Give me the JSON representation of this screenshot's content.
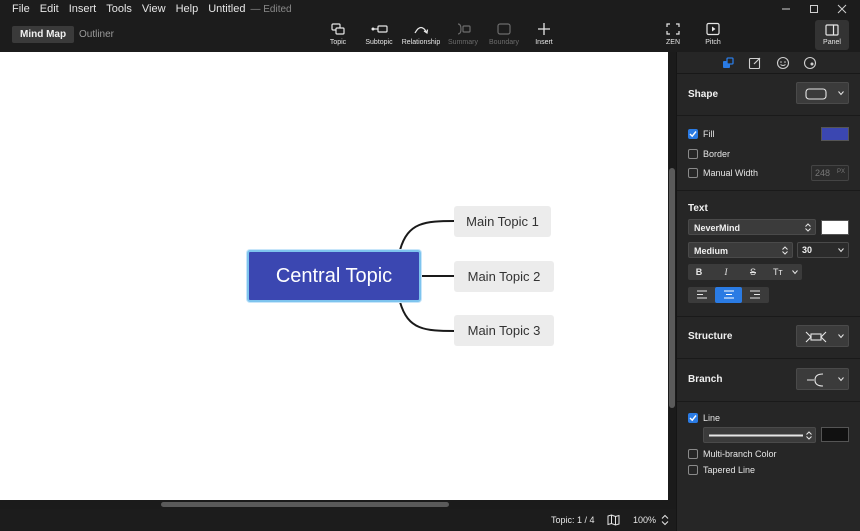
{
  "menu": {
    "items": [
      "File",
      "Edit",
      "Insert",
      "Tools",
      "View",
      "Help"
    ],
    "doc_title": "Untitled",
    "doc_status": "— Edited"
  },
  "view_tabs": {
    "mind_map": "Mind Map",
    "outliner": "Outliner"
  },
  "toolbar": {
    "topic": "Topic",
    "subtopic": "Subtopic",
    "relationship": "Relationship",
    "summary": "Summary",
    "boundary": "Boundary",
    "insert": "Insert",
    "zen": "ZEN",
    "pitch": "Pitch",
    "panel": "Panel"
  },
  "mindmap": {
    "central": "Central Topic",
    "topics": [
      "Main Topic 1",
      "Main Topic 2",
      "Main Topic 3"
    ]
  },
  "status": {
    "topic_count": "Topic: 1 / 4",
    "zoom": "100%"
  },
  "panel": {
    "shape": {
      "title": "Shape"
    },
    "fill": {
      "label": "Fill",
      "checked": true,
      "color": "#3b47b1"
    },
    "border": {
      "label": "Border",
      "checked": false
    },
    "manual_width": {
      "label": "Manual Width",
      "checked": false,
      "value": "248",
      "unit": "PX"
    },
    "text": {
      "title": "Text",
      "font": "NeverMind",
      "color": "#ffffff",
      "weight": "Medium",
      "size": "30",
      "bold": "B",
      "italic": "I",
      "strike": "S",
      "case": "Tт"
    },
    "structure": {
      "title": "Structure"
    },
    "branch": {
      "title": "Branch"
    },
    "line": {
      "label": "Line",
      "checked": true,
      "color": "#111111"
    },
    "multi_branch_color": {
      "label": "Multi-branch Color",
      "checked": false
    },
    "tapered_line": {
      "label": "Tapered Line",
      "checked": false
    }
  },
  "colors": {
    "accent": "#2a7be4",
    "central_fill": "#3b47b1",
    "selection": "#7ec4ee"
  }
}
